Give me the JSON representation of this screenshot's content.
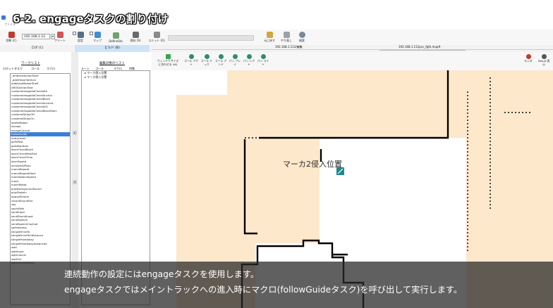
{
  "slide": {
    "title": "6-2. engageタスクの割り付け",
    "caption_line1": "連続動作の設定にはengageタスクを使用します。",
    "caption_line2": "engageタスクではメイントラックへの進入時にマクロ(followGuideタスク)を呼び出して実行します。"
  },
  "window": {
    "menu_text": "ファイル"
  },
  "toolbar": {
    "connect_label": "切断 (C)",
    "ip_value": "192.168.1.12",
    "fleet_label": "フリート",
    "settings_label": "設定",
    "map_label": "マップ",
    "define_label": "DefineSta",
    "save_label": "保存 (S)",
    "commit_label": "コミット (O)",
    "undo_label": "元に戻す",
    "redo_label": "やり直し",
    "search_label": "検索"
  },
  "tabs": {
    "robot_tab": "ロボ (C)",
    "build_tab": "ビルド (B)",
    "map_tab": "192.168.1.112/.../pidmap#",
    "map_path_left": "192.168.1.112/編集",
    "map_path_right": "192.168.1.112pcc_fgth.map#"
  },
  "left_panel": {
    "group_label": "ワークリスト",
    "col_robot": "ロボットタスク",
    "col_goal": "ゴール",
    "col_macro": "マクロ",
    "tasks": [
      "_ambientActionStart",
      "_add2DoorVertical",
      "addAmpMarkerShelf",
      "ARGSActionTask",
      "customeImageAdCheckAllt",
      "customeImageAdCheckAnchor",
      "customeImageAdCheckBlock",
      "customeImageAdCheckAnchort",
      "customeImageAdCheckAll2",
      "customeImageAdCheckBlockStart",
      "customeDelayOff",
      "customeDelayOn",
      "deleteRobot",
      "escape",
      "escapeCancel",
      "followGuide",
      "entryLevel",
      "goToPost",
      "gotoRandom",
      "laserCheckBlock",
      "laserCheckMaxDist",
      "laserCheckTime",
      "laserSpeed",
      "localizeAllPose",
      "macroRepeat",
      "macroRepeatStart",
      "mainStationSpeed",
      "move",
      "moveRobot",
      "playBackgroundSound",
      "playStateIn",
      "popupSimple",
      "recordSoundFile",
      "say",
      "sayInPath",
      "sendInput",
      "sendSoundInput",
      "sendSpeech",
      "sendSpeechCached",
      "setHeading",
      "tAngleDriveTo",
      "tAngleDriveTo2distance",
      "tAnglePointAway",
      "tAnglePointAwayAdvanced",
      "wait",
      "waitInput",
      "waitCancel",
      "waitFull",
      "waitLessIdleBody"
    ],
    "selected_index": 15
  },
  "mid_panel": {
    "group_label": "編集対象のリスト",
    "col_route": "ルート",
    "col_goal": "ゴール",
    "col_macro": "マクロ",
    "col_special": "特殊",
    "tree_items": [
      "マーカ侵入位置",
      "マーカ侵入位置"
    ]
  },
  "map_toolbar": {
    "fit_label": "ウィンドウサイズに合わせる (W)",
    "btn1": "ゴール アクト",
    "btn2": "ゴール ドック",
    "btn3": "ゴール アンド",
    "btn4": "パン プレイ",
    "btn5": "パン レクト",
    "btn6": "パン ライト",
    "btn7": "モニタ",
    "btn8": "Defult 表示"
  },
  "map": {
    "label": "マーカ2侵入位置",
    "area_color": "#fde8cc",
    "wall_color": "#000000"
  },
  "colors": {
    "accent": "#3b7fd8",
    "caption_bg": "#3a3a3a",
    "goal_marker": "#1f8a8a"
  }
}
